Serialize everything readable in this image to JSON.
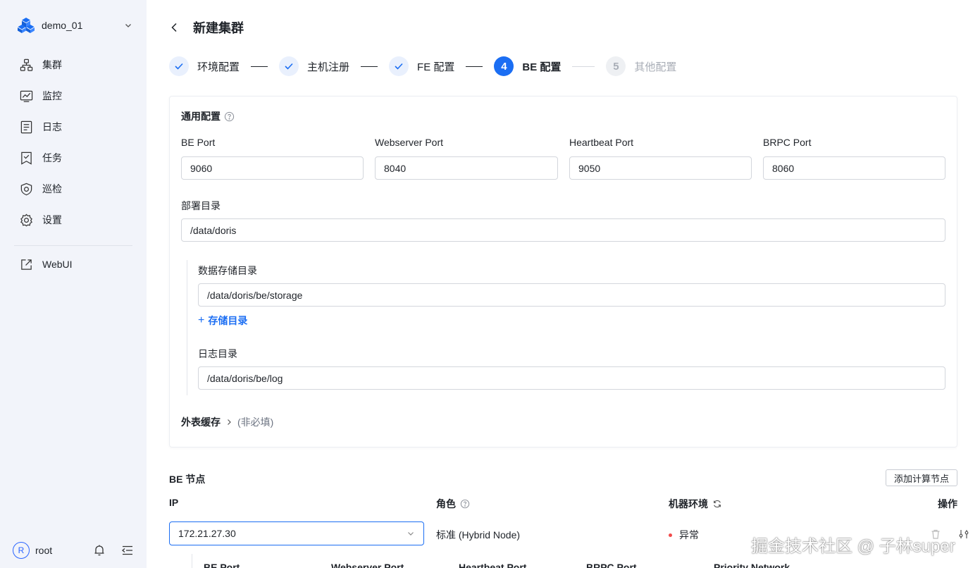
{
  "sidebar": {
    "project": "demo_01",
    "items": [
      {
        "label": "集群",
        "icon": "cluster-icon"
      },
      {
        "label": "监控",
        "icon": "monitor-icon"
      },
      {
        "label": "日志",
        "icon": "log-icon"
      },
      {
        "label": "任务",
        "icon": "task-icon"
      },
      {
        "label": "巡检",
        "icon": "inspect-icon"
      },
      {
        "label": "设置",
        "icon": "gear-icon"
      }
    ],
    "webui": "WebUI",
    "user": {
      "avatar": "R",
      "name": "root"
    }
  },
  "header": {
    "title": "新建集群"
  },
  "steps": [
    {
      "num": "",
      "label": "环境配置",
      "state": "done"
    },
    {
      "num": "",
      "label": "主机注册",
      "state": "done"
    },
    {
      "num": "",
      "label": "FE 配置",
      "state": "done"
    },
    {
      "num": "4",
      "label": "BE 配置",
      "state": "current"
    },
    {
      "num": "5",
      "label": "其他配置",
      "state": "todo"
    }
  ],
  "general": {
    "title": "通用配置",
    "fields": [
      {
        "label": "BE Port",
        "value": "9060"
      },
      {
        "label": "Webserver Port",
        "value": "8040"
      },
      {
        "label": "Heartbeat Port",
        "value": "9050"
      },
      {
        "label": "BRPC Port",
        "value": "8060"
      }
    ],
    "deploy_label": "部署目录",
    "deploy_value": "/data/doris",
    "storage_label": "数据存储目录",
    "storage_value": "/data/doris/be/storage",
    "add_storage": "存储目录",
    "log_label": "日志目录",
    "log_value": "/data/doris/be/log",
    "external_cache": "外表缓存",
    "optional": "(非必填)"
  },
  "be_nodes": {
    "title": "BE 节点",
    "add_button": "添加计算节点",
    "columns": {
      "ip": "IP",
      "role": "角色",
      "env": "机器环境",
      "ops": "操作"
    },
    "rows": [
      {
        "ip": "172.21.27.30",
        "role": "标准 (Hybrid Node)",
        "status": "异常"
      }
    ],
    "sub_columns": [
      "BE Port",
      "Webserver Port",
      "Heartbeat Port",
      "BRPC Port",
      "Priority Network"
    ]
  },
  "watermark": "掘金技术社区 @ 子林super",
  "colors": {
    "primary": "#1b6ef3",
    "error": "#f24a4a",
    "sidebar_bg": "#f2f4fa"
  }
}
